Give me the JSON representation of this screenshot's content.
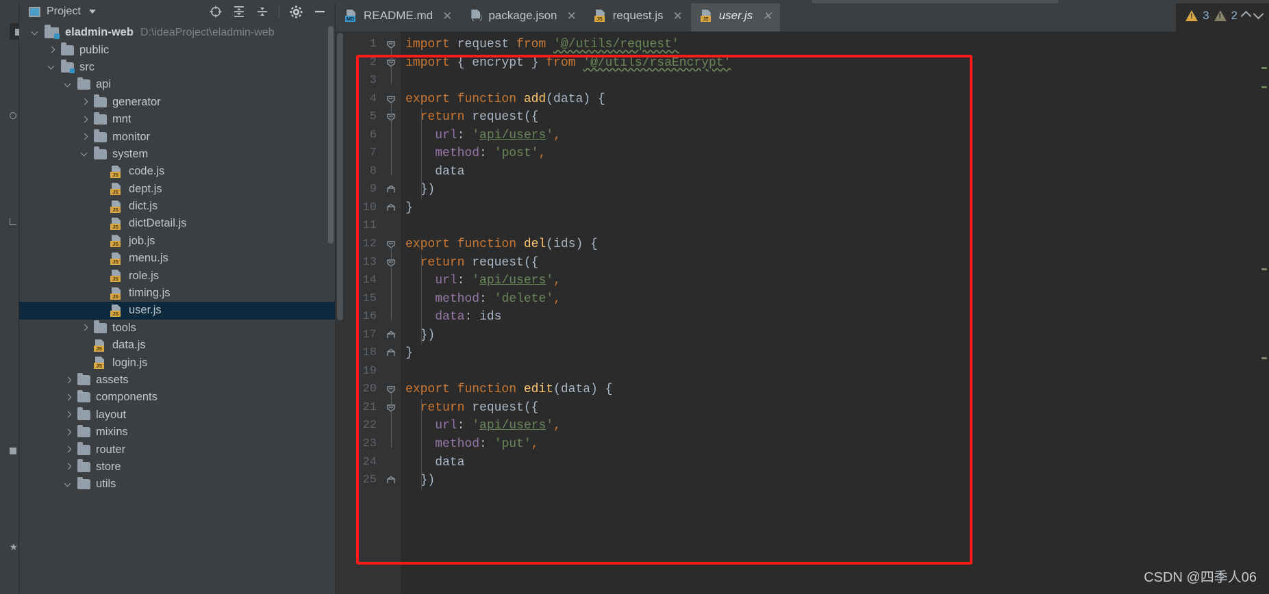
{
  "window": {
    "tool_strip": [
      {
        "label": "Project",
        "icon": "project-window-icon",
        "active": true
      },
      {
        "label": "Commit",
        "icon": "commit-icon",
        "active": false
      },
      {
        "label": "Pull Requests",
        "icon": "pull-request-icon",
        "active": false
      },
      {
        "label": "Structure",
        "icon": "structure-icon",
        "active": false
      },
      {
        "label": "Favorites",
        "icon": "star-icon",
        "active": false
      }
    ]
  },
  "project_panel": {
    "title": "Project",
    "toolbar": [
      {
        "name": "scroll-from-source-icon",
        "tooltip": "Select Opened File"
      },
      {
        "name": "expand-all-icon",
        "tooltip": "Expand All"
      },
      {
        "name": "collapse-all-icon",
        "tooltip": "Collapse All"
      },
      {
        "name": "gear-icon",
        "tooltip": "Options"
      },
      {
        "name": "minimize-icon",
        "tooltip": "Hide"
      }
    ],
    "root": {
      "label": "eladmin-web",
      "path": "D:\\ideaProject\\eladmin-web"
    },
    "tree": [
      {
        "label": "eladmin-web",
        "path": "D:\\ideaProject\\eladmin-web",
        "type": "project",
        "depth": 0,
        "state": "open",
        "bold": true
      },
      {
        "label": "public",
        "type": "folder",
        "depth": 1,
        "state": "closed"
      },
      {
        "label": "src",
        "type": "folder-src",
        "depth": 1,
        "state": "open"
      },
      {
        "label": "api",
        "type": "folder",
        "depth": 2,
        "state": "open"
      },
      {
        "label": "generator",
        "type": "folder",
        "depth": 3,
        "state": "closed"
      },
      {
        "label": "mnt",
        "type": "folder",
        "depth": 3,
        "state": "closed"
      },
      {
        "label": "monitor",
        "type": "folder",
        "depth": 3,
        "state": "closed"
      },
      {
        "label": "system",
        "type": "folder",
        "depth": 3,
        "state": "open"
      },
      {
        "label": "code.js",
        "type": "js",
        "depth": 4,
        "state": "leaf"
      },
      {
        "label": "dept.js",
        "type": "js",
        "depth": 4,
        "state": "leaf"
      },
      {
        "label": "dict.js",
        "type": "js",
        "depth": 4,
        "state": "leaf"
      },
      {
        "label": "dictDetail.js",
        "type": "js",
        "depth": 4,
        "state": "leaf"
      },
      {
        "label": "job.js",
        "type": "js",
        "depth": 4,
        "state": "leaf"
      },
      {
        "label": "menu.js",
        "type": "js",
        "depth": 4,
        "state": "leaf"
      },
      {
        "label": "role.js",
        "type": "js",
        "depth": 4,
        "state": "leaf"
      },
      {
        "label": "timing.js",
        "type": "js",
        "depth": 4,
        "state": "leaf"
      },
      {
        "label": "user.js",
        "type": "js",
        "depth": 4,
        "state": "leaf",
        "selected": true
      },
      {
        "label": "tools",
        "type": "folder",
        "depth": 3,
        "state": "closed"
      },
      {
        "label": "data.js",
        "type": "js",
        "depth": 3,
        "state": "leaf"
      },
      {
        "label": "login.js",
        "type": "js",
        "depth": 3,
        "state": "leaf"
      },
      {
        "label": "assets",
        "type": "folder",
        "depth": 2,
        "state": "closed"
      },
      {
        "label": "components",
        "type": "folder",
        "depth": 2,
        "state": "closed"
      },
      {
        "label": "layout",
        "type": "folder",
        "depth": 2,
        "state": "closed"
      },
      {
        "label": "mixins",
        "type": "folder",
        "depth": 2,
        "state": "closed"
      },
      {
        "label": "router",
        "type": "folder",
        "depth": 2,
        "state": "closed"
      },
      {
        "label": "store",
        "type": "folder",
        "depth": 2,
        "state": "closed"
      },
      {
        "label": "utils",
        "type": "folder",
        "depth": 2,
        "state": "open"
      }
    ]
  },
  "editor": {
    "tabs": [
      {
        "label": "README.md",
        "icon": "md-file-icon",
        "active": false,
        "closeable": true
      },
      {
        "label": "package.json",
        "icon": "json-file-icon",
        "active": false,
        "closeable": true
      },
      {
        "label": "request.js",
        "icon": "js-file-icon",
        "active": false,
        "closeable": true
      },
      {
        "label": "user.js",
        "icon": "js-file-icon",
        "active": true,
        "closeable": true
      }
    ],
    "close_glyph": "✕",
    "first_line": 1,
    "last_line": 25,
    "lines": [
      {
        "n": 1,
        "tokens": [
          {
            "t": "import",
            "c": "kw"
          },
          {
            "t": " request ",
            "c": "id"
          },
          {
            "t": "from",
            "c": "kw"
          },
          {
            "t": " ",
            "c": "id"
          },
          {
            "t": "'@/utils/request'",
            "c": "str squig"
          }
        ],
        "fold": "start"
      },
      {
        "n": 2,
        "tokens": [
          {
            "t": "import",
            "c": "kw"
          },
          {
            "t": " { encrypt } ",
            "c": "id"
          },
          {
            "t": "from",
            "c": "kw"
          },
          {
            "t": " ",
            "c": "id"
          },
          {
            "t": "'@/utils/rsaEncrypt'",
            "c": "str squig"
          }
        ],
        "fold": "end"
      },
      {
        "n": 3,
        "tokens": [],
        "fold": ""
      },
      {
        "n": 4,
        "tokens": [
          {
            "t": "export function ",
            "c": "kw"
          },
          {
            "t": "add",
            "c": "fn"
          },
          {
            "t": "(data) {",
            "c": "punct"
          }
        ],
        "fold": "start"
      },
      {
        "n": 5,
        "tokens": [
          {
            "t": "  ",
            "c": "id"
          },
          {
            "t": "return",
            "c": "kw"
          },
          {
            "t": " request({",
            "c": "id"
          }
        ],
        "fold": "start"
      },
      {
        "n": 6,
        "tokens": [
          {
            "t": "    ",
            "c": "id"
          },
          {
            "t": "url",
            "c": "prop"
          },
          {
            "t": ": ",
            "c": "punct"
          },
          {
            "t": "'",
            "c": "str"
          },
          {
            "t": "api/users",
            "c": "str lnk"
          },
          {
            "t": "'",
            "c": "str"
          },
          {
            "t": ",",
            "c": "kw"
          }
        ],
        "fold": ""
      },
      {
        "n": 7,
        "tokens": [
          {
            "t": "    ",
            "c": "id"
          },
          {
            "t": "method",
            "c": "prop"
          },
          {
            "t": ": ",
            "c": "punct"
          },
          {
            "t": "'post'",
            "c": "str"
          },
          {
            "t": ",",
            "c": "kw"
          }
        ],
        "fold": ""
      },
      {
        "n": 8,
        "tokens": [
          {
            "t": "    data",
            "c": "id"
          }
        ],
        "fold": ""
      },
      {
        "n": 9,
        "tokens": [
          {
            "t": "  })",
            "c": "id"
          }
        ],
        "fold": "close"
      },
      {
        "n": 10,
        "tokens": [
          {
            "t": "}",
            "c": "id"
          }
        ],
        "fold": "close"
      },
      {
        "n": 11,
        "tokens": [],
        "fold": ""
      },
      {
        "n": 12,
        "tokens": [
          {
            "t": "export function ",
            "c": "kw"
          },
          {
            "t": "del",
            "c": "fn"
          },
          {
            "t": "(ids) {",
            "c": "punct"
          }
        ],
        "fold": "start"
      },
      {
        "n": 13,
        "tokens": [
          {
            "t": "  ",
            "c": "id"
          },
          {
            "t": "return",
            "c": "kw"
          },
          {
            "t": " request({",
            "c": "id"
          }
        ],
        "fold": "start"
      },
      {
        "n": 14,
        "tokens": [
          {
            "t": "    ",
            "c": "id"
          },
          {
            "t": "url",
            "c": "prop"
          },
          {
            "t": ": ",
            "c": "punct"
          },
          {
            "t": "'",
            "c": "str"
          },
          {
            "t": "api/users",
            "c": "str lnk"
          },
          {
            "t": "'",
            "c": "str"
          },
          {
            "t": ",",
            "c": "kw"
          }
        ],
        "fold": ""
      },
      {
        "n": 15,
        "tokens": [
          {
            "t": "    ",
            "c": "id"
          },
          {
            "t": "method",
            "c": "prop"
          },
          {
            "t": ": ",
            "c": "punct"
          },
          {
            "t": "'delete'",
            "c": "str"
          },
          {
            "t": ",",
            "c": "kw"
          }
        ],
        "fold": ""
      },
      {
        "n": 16,
        "tokens": [
          {
            "t": "    ",
            "c": "id"
          },
          {
            "t": "data",
            "c": "prop"
          },
          {
            "t": ": ids",
            "c": "id"
          }
        ],
        "fold": ""
      },
      {
        "n": 17,
        "tokens": [
          {
            "t": "  })",
            "c": "id"
          }
        ],
        "fold": "close"
      },
      {
        "n": 18,
        "tokens": [
          {
            "t": "}",
            "c": "id"
          }
        ],
        "fold": "close"
      },
      {
        "n": 19,
        "tokens": [],
        "fold": ""
      },
      {
        "n": 20,
        "tokens": [
          {
            "t": "export function ",
            "c": "kw"
          },
          {
            "t": "edit",
            "c": "fn"
          },
          {
            "t": "(data) {",
            "c": "punct"
          }
        ],
        "fold": "start"
      },
      {
        "n": 21,
        "tokens": [
          {
            "t": "  ",
            "c": "id"
          },
          {
            "t": "return",
            "c": "kw"
          },
          {
            "t": " request({",
            "c": "id"
          }
        ],
        "fold": "start"
      },
      {
        "n": 22,
        "tokens": [
          {
            "t": "    ",
            "c": "id"
          },
          {
            "t": "url",
            "c": "prop"
          },
          {
            "t": ": ",
            "c": "punct"
          },
          {
            "t": "'",
            "c": "str"
          },
          {
            "t": "api/users",
            "c": "str lnk"
          },
          {
            "t": "'",
            "c": "str"
          },
          {
            "t": ",",
            "c": "kw"
          }
        ],
        "fold": ""
      },
      {
        "n": 23,
        "tokens": [
          {
            "t": "    ",
            "c": "id"
          },
          {
            "t": "method",
            "c": "prop"
          },
          {
            "t": ": ",
            "c": "punct"
          },
          {
            "t": "'put'",
            "c": "str"
          },
          {
            "t": ",",
            "c": "kw"
          }
        ],
        "fold": ""
      },
      {
        "n": 24,
        "tokens": [
          {
            "t": "    data",
            "c": "id"
          }
        ],
        "fold": ""
      },
      {
        "n": 25,
        "tokens": [
          {
            "t": "  })",
            "c": "id"
          }
        ],
        "fold": "close"
      }
    ]
  },
  "inspection_widget": {
    "warning_count": "3",
    "weak_warning_count": "2",
    "prev_glyph": "^",
    "next_glyph": "v"
  },
  "annotation": {
    "shape": "rectangle",
    "color": "#ff1a1a"
  },
  "watermark": {
    "text": "CSDN @四季人06"
  },
  "colors": {
    "panel_bg": "#3c3f41",
    "editor_bg": "#2b2b2b",
    "gutter_bg": "#313335",
    "selection_bg": "#0d293e",
    "keyword": "#cc7832",
    "string": "#6a8759",
    "function": "#ffc66d",
    "property": "#9876aa",
    "text": "#a9b7c6",
    "accent": "#3592c4",
    "warning": "#d9a642"
  }
}
